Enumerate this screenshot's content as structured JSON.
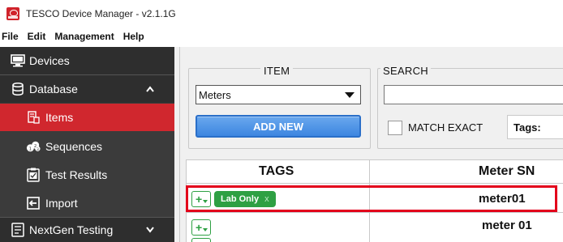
{
  "window": {
    "title": "TESCO Device Manager - v2.1.1G"
  },
  "menu": [
    "File",
    "Edit",
    "Management",
    "Help"
  ],
  "sidebar": {
    "items": [
      {
        "label": "Devices",
        "icon": "monitor-icon"
      },
      {
        "label": "Database",
        "icon": "database-icon",
        "chevron": "^"
      },
      {
        "label": "Items",
        "icon": "items-icon",
        "active": true
      },
      {
        "label": "Sequences",
        "icon": "sequences-icon"
      },
      {
        "label": "Test Results",
        "icon": "test-results-icon"
      },
      {
        "label": "Import",
        "icon": "import-icon"
      },
      {
        "label": "NextGen Testing",
        "icon": "nextgen-icon",
        "chevron": "v"
      }
    ]
  },
  "item_panel": {
    "label": "ITEM",
    "select_value": "Meters",
    "add_new_label": "ADD NEW"
  },
  "search_panel": {
    "label": "SEARCH",
    "input_value": "",
    "match_exact_label": "MATCH EXACT",
    "match_exact_checked": false,
    "tags_label": "Tags:"
  },
  "table": {
    "columns": [
      "TAGS",
      "Meter SN"
    ],
    "rows": [
      {
        "tags": [
          "Lab Only"
        ],
        "meter_sn": "meter01",
        "highlighted": true
      },
      {
        "tags": [],
        "meter_sn": "meter 01",
        "highlighted": false
      }
    ],
    "tag_remove_glyph": "x",
    "add_tag_glyph": "+"
  },
  "colors": {
    "accent": "#d0272e",
    "sidebar": "#3b3b3b",
    "tag_green": "#2ea043",
    "button_blue": "#3d86e0",
    "highlight": "#e3001b"
  }
}
